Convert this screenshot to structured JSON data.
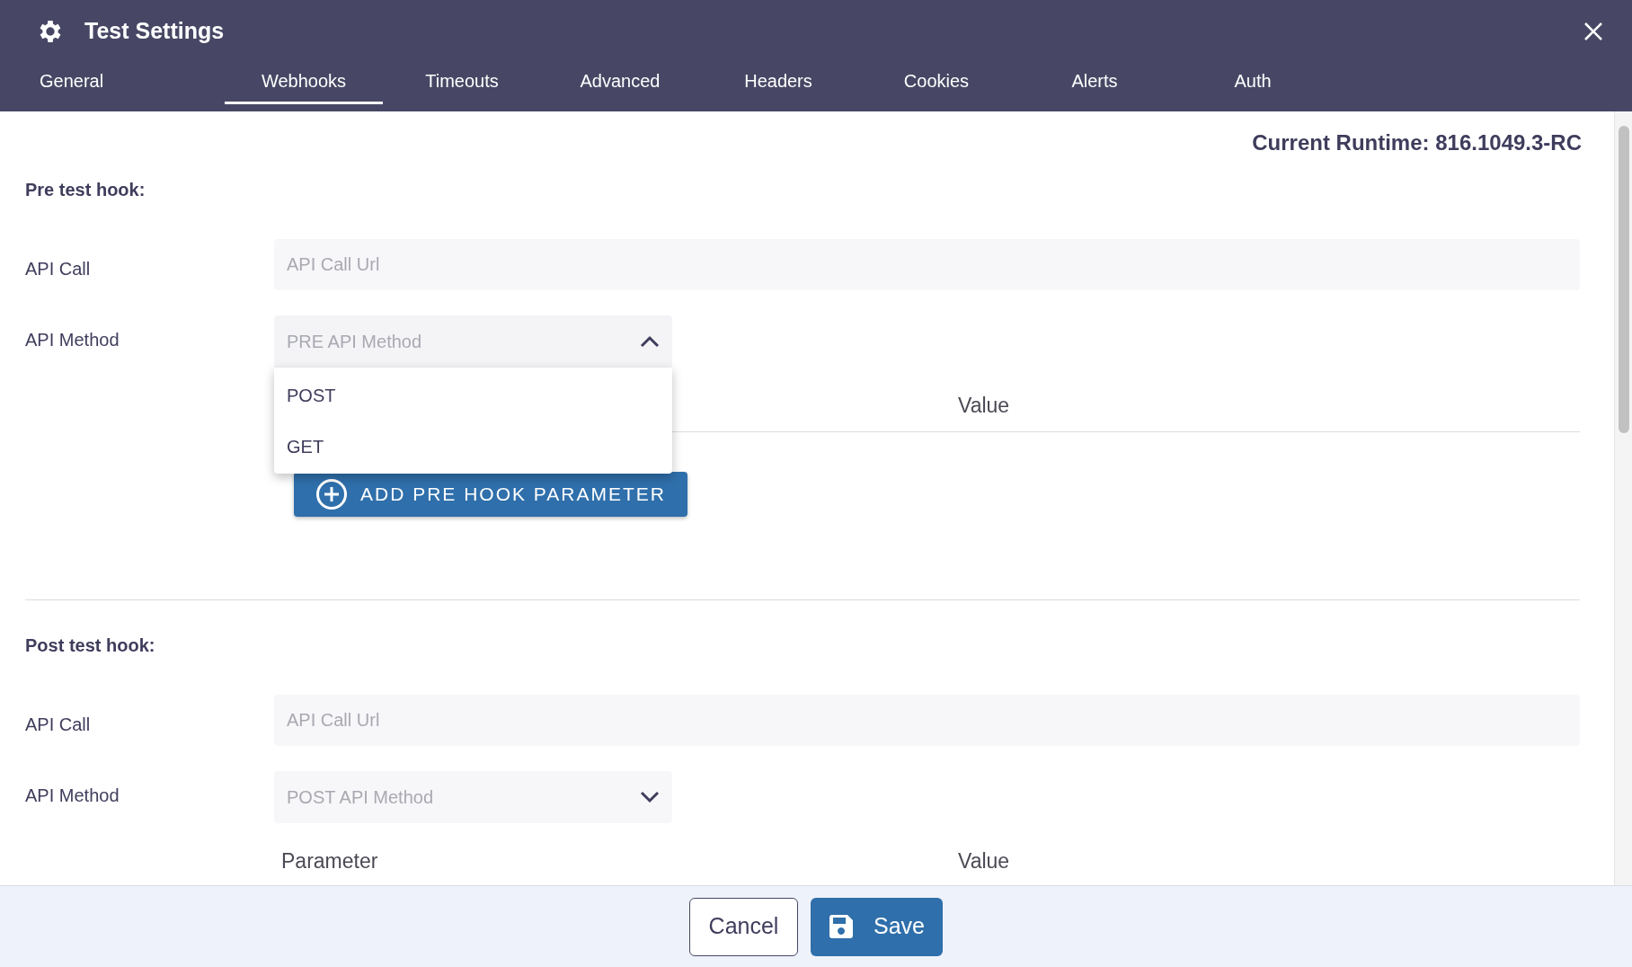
{
  "dialog": {
    "title": "Test Settings"
  },
  "tabs": [
    {
      "label": "General",
      "selected": false
    },
    {
      "label": "Webhooks",
      "selected": true
    },
    {
      "label": "Timeouts",
      "selected": false
    },
    {
      "label": "Advanced",
      "selected": false
    },
    {
      "label": "Headers",
      "selected": false
    },
    {
      "label": "Cookies",
      "selected": false
    },
    {
      "label": "Alerts",
      "selected": false
    },
    {
      "label": "Auth",
      "selected": false
    }
  ],
  "runtime": "Current Runtime: 816.1049.3-RC",
  "sections": [
    {
      "title": "Pre test hook:",
      "api_call": {
        "label": "API Call",
        "placeholder": "API Call Url"
      },
      "api_method": {
        "label": "API Method",
        "placeholder": "PRE API Method",
        "expanded": true,
        "options": [
          "POST",
          "GET"
        ]
      },
      "columns": {
        "column_2": "Value"
      },
      "add_button": "ADD PRE HOOK PARAMETER"
    },
    {
      "title": "Post test hook:",
      "api_call": {
        "label": "API Call",
        "placeholder": "API Call Url"
      },
      "api_method": {
        "label": "API Method",
        "placeholder": "POST API Method",
        "expanded": false
      },
      "columns": {
        "column_1": "Parameter",
        "column_2": "Value"
      }
    }
  ],
  "footer": {
    "cancel": "Cancel",
    "save": "Save"
  }
}
